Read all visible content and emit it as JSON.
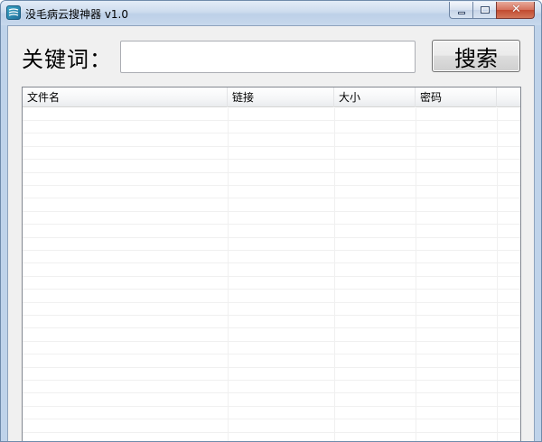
{
  "window": {
    "title": "没毛病云搜神器 v1.0",
    "icon": "app-cloud-icon",
    "close_glyph": "✕"
  },
  "search": {
    "label": "关键词：",
    "value": "",
    "placeholder": "",
    "button_label": "搜索"
  },
  "results": {
    "columns": [
      "文件名",
      "链接",
      "大小",
      "密码"
    ],
    "rows": []
  },
  "colors": {
    "frame": "#bfd3ea",
    "client_bg": "#f0f0f0",
    "close_button": "#c24a30"
  }
}
